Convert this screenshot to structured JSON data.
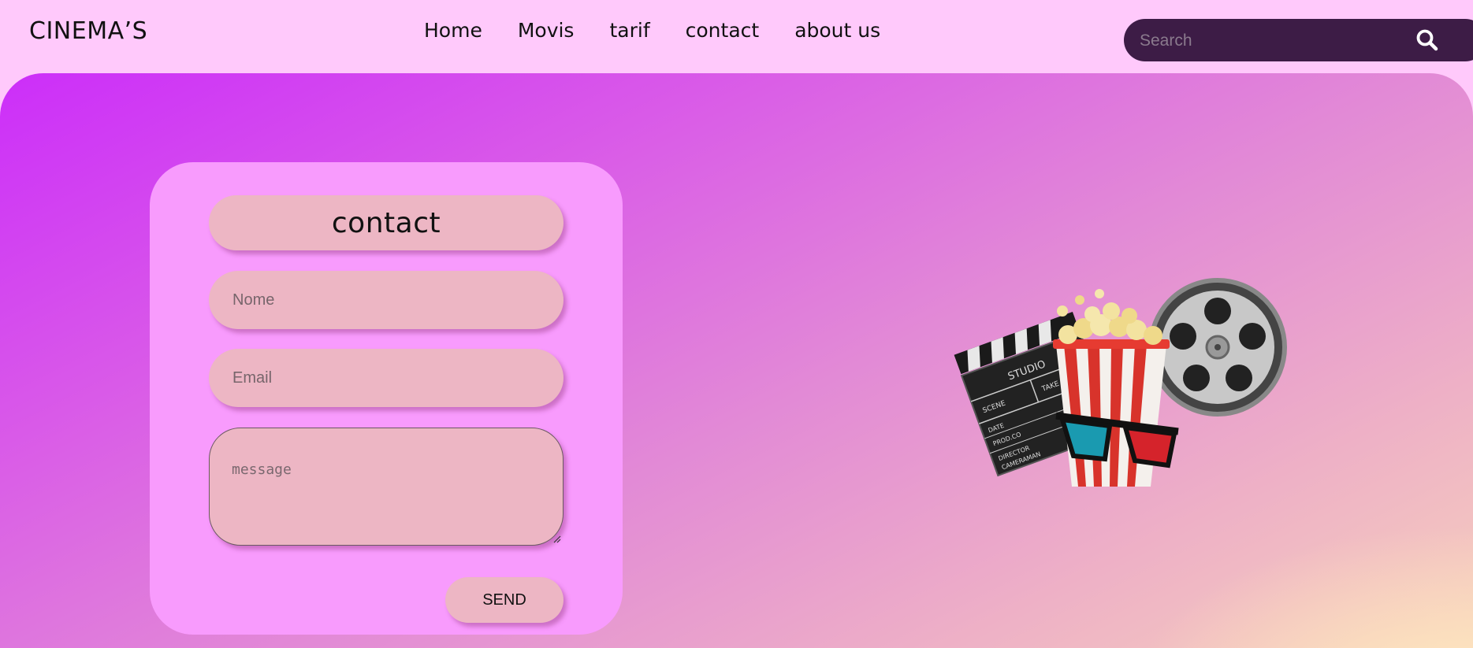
{
  "header": {
    "logo": "CINEMA’S",
    "nav": [
      {
        "label": "Home"
      },
      {
        "label": "Movis"
      },
      {
        "label": "tarif"
      },
      {
        "label": "contact"
      },
      {
        "label": "about us"
      }
    ],
    "search": {
      "placeholder": "Search",
      "icon": "search-icon"
    }
  },
  "contact_form": {
    "title": "contact",
    "name_placeholder": "Nome",
    "email_placeholder": "Email",
    "message_placeholder": "message",
    "send_label": "SEND"
  },
  "illustration": {
    "icons": [
      "clapperboard-icon",
      "popcorn-icon",
      "3d-glasses-icon",
      "film-reel-icon"
    ],
    "clapper_text": [
      "STUDIO",
      "SCENE",
      "TAKE",
      "DATE",
      "PROD.CO",
      "DIRECTOR",
      "CAMERAMAN"
    ]
  },
  "colors": {
    "header_bg": "#ffc9fb",
    "search_bg": "#3d1c46",
    "card_bg": "#f89bfd",
    "field_bg": "#edb6c4",
    "gradient_start": "#cc2ef9",
    "gradient_end": "#f6cfbd"
  }
}
